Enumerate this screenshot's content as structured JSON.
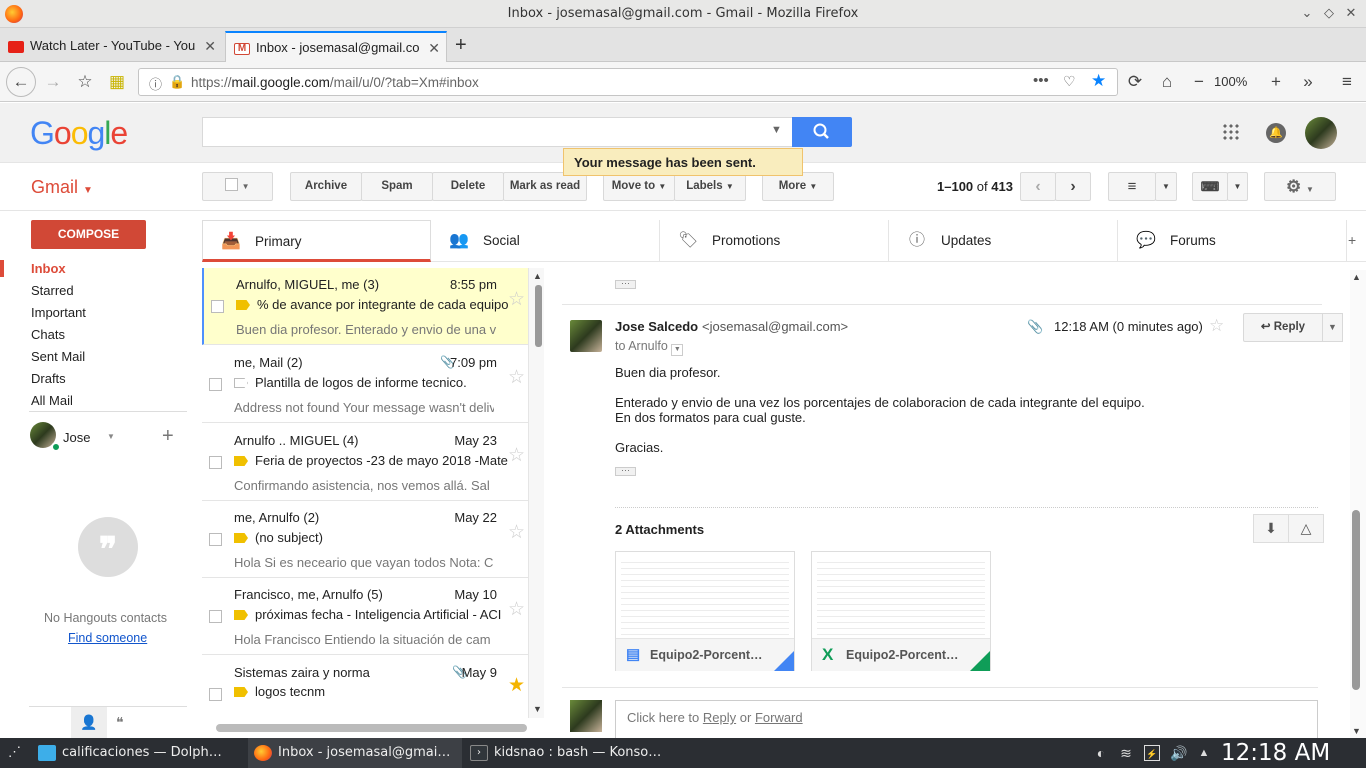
{
  "window": {
    "title": "Inbox - josemasal@gmail.com - Gmail - Mozilla Firefox"
  },
  "tabs": [
    {
      "label": "Watch Later - YouTube - You",
      "icon": "youtube-icon"
    },
    {
      "label": "Inbox - josemasal@gmail.co",
      "icon": "gmail-icon"
    }
  ],
  "navbar": {
    "url_prefix": "https://",
    "url_host": "mail.google.com",
    "url_path": "/mail/u/0/?tab=Xm#inbox",
    "zoom": "100%"
  },
  "header": {
    "logo": "Google",
    "search_placeholder": "",
    "toast": "Your message has been sent."
  },
  "toolbar": {
    "app_label": "Gmail",
    "archive": "Archive",
    "spam": "Spam",
    "delete": "Delete",
    "mark_read": "Mark as read",
    "move_to": "Move to",
    "labels": "Labels",
    "more": "More",
    "page_range": "1–100",
    "page_of": "of",
    "page_total": "413"
  },
  "sidebar": {
    "compose": "COMPOSE",
    "items": [
      "Inbox",
      "Starred",
      "Important",
      "Chats",
      "Sent Mail",
      "Drafts",
      "All Mail"
    ],
    "user": "Jose",
    "hangouts_empty": "No Hangouts contacts",
    "find_someone": "Find someone"
  },
  "categories": [
    "Primary",
    "Social",
    "Promotions",
    "Updates",
    "Forums"
  ],
  "threads": [
    {
      "from": "Arnulfo, MIGUEL, me (3)",
      "date": "8:55 pm",
      "subject": "% de avance por integrante de cada equipo",
      "snippet": "Buen dia profesor. Enterado y envio de una v",
      "clip": false,
      "starred": false,
      "label": "yellow"
    },
    {
      "from": "me, Mail (2)",
      "date": "7:09 pm",
      "subject": "Plantilla de logos de informe tecnico.",
      "snippet": "Address not found Your message wasn't deliv",
      "clip": true,
      "starred": false,
      "label": "gray"
    },
    {
      "from": "Arnulfo .. MIGUEL (4)",
      "date": "May 23",
      "subject": "Feria de proyectos -23 de mayo 2018 -Mate",
      "snippet": "Confirmando asistencia, nos vemos allá. Sal",
      "clip": false,
      "starred": false,
      "label": "yellow"
    },
    {
      "from": "me, Arnulfo (2)",
      "date": "May 22",
      "subject": "(no subject)",
      "snippet": "Hola Si es neceario que vayan todos Nota: C",
      "clip": false,
      "starred": false,
      "label": "yellow"
    },
    {
      "from": "Francisco, me, Arnulfo (5)",
      "date": "May 10",
      "subject": "próximas fecha - Inteligencia Artificial - ACI",
      "snippet": "Hola Francisco Entiendo la situación de cam",
      "clip": false,
      "starred": false,
      "label": "yellow"
    },
    {
      "from": "Sistemas zaira y norma",
      "date": "May 9",
      "subject": "logos tecnm",
      "snippet": "",
      "clip": true,
      "starred": true,
      "label": "yellow"
    }
  ],
  "message": {
    "sender_name": "Jose Salcedo",
    "sender_email": "<josemasal@gmail.com>",
    "to": "to Arnulfo",
    "time": "12:18 AM (0 minutes ago)",
    "reply": "Reply",
    "body": [
      "Buen dia profesor.",
      "Enterado y envio de una vez los porcentajes de colaboracion de cada integrante del equipo.",
      "En dos formatos para cual guste.",
      "Gracias."
    ],
    "attachments_title": "2 Attachments",
    "attachments": [
      {
        "name": "Equipo2-Porcent…",
        "type": "doc"
      },
      {
        "name": "Equipo2-Porcent…",
        "type": "sheet"
      }
    ],
    "reply_box": {
      "prefix": "Click here to",
      "reply": "Reply",
      "or": "or",
      "forward": "Forward"
    }
  },
  "taskbar": {
    "items": [
      "calificaciones — Dolph…",
      "Inbox - josemasal@gmai…",
      "kidsnao : bash — Konso…"
    ],
    "clock": "12:18 AM"
  }
}
